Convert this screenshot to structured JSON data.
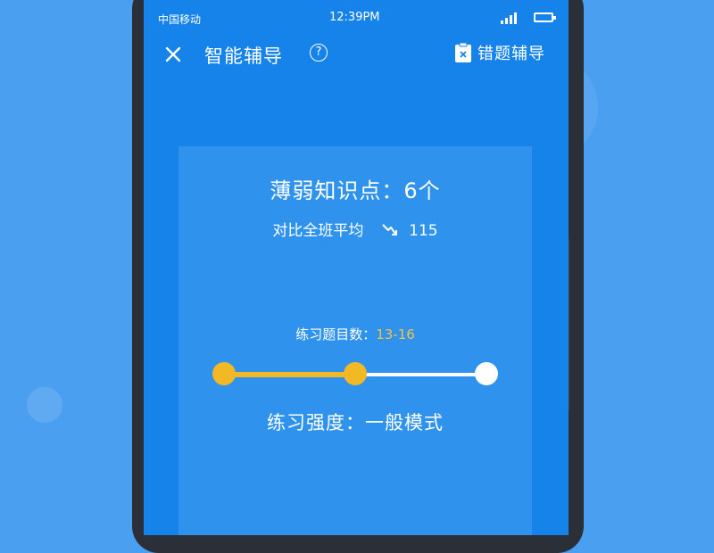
{
  "status_bar": {
    "carrier": "中国移动",
    "time": "12:39PM"
  },
  "app_bar": {
    "close_icon": "close-icon",
    "title": "智能辅导",
    "help_label": "?",
    "wrong_questions_label": "错题辅导",
    "wrong_questions_icon": "clipboard-x-icon"
  },
  "card": {
    "weak_points_title": "薄弱知识点：6个",
    "compare_label": "对比全班平均",
    "compare_icon": "trend-down-icon",
    "compare_value": "115",
    "practice_count_label": "练习题目数：",
    "practice_count_value": "13-16",
    "intensity_label": "练习强度：一般模式"
  },
  "slider": {
    "levels": 3,
    "selected_level": 2,
    "fill_color": "#f3b925",
    "track_color": "#ffffff"
  },
  "colors": {
    "screen_bg": "#1583ea",
    "card_bg": "#2f93ee",
    "accent": "#f5c242"
  }
}
